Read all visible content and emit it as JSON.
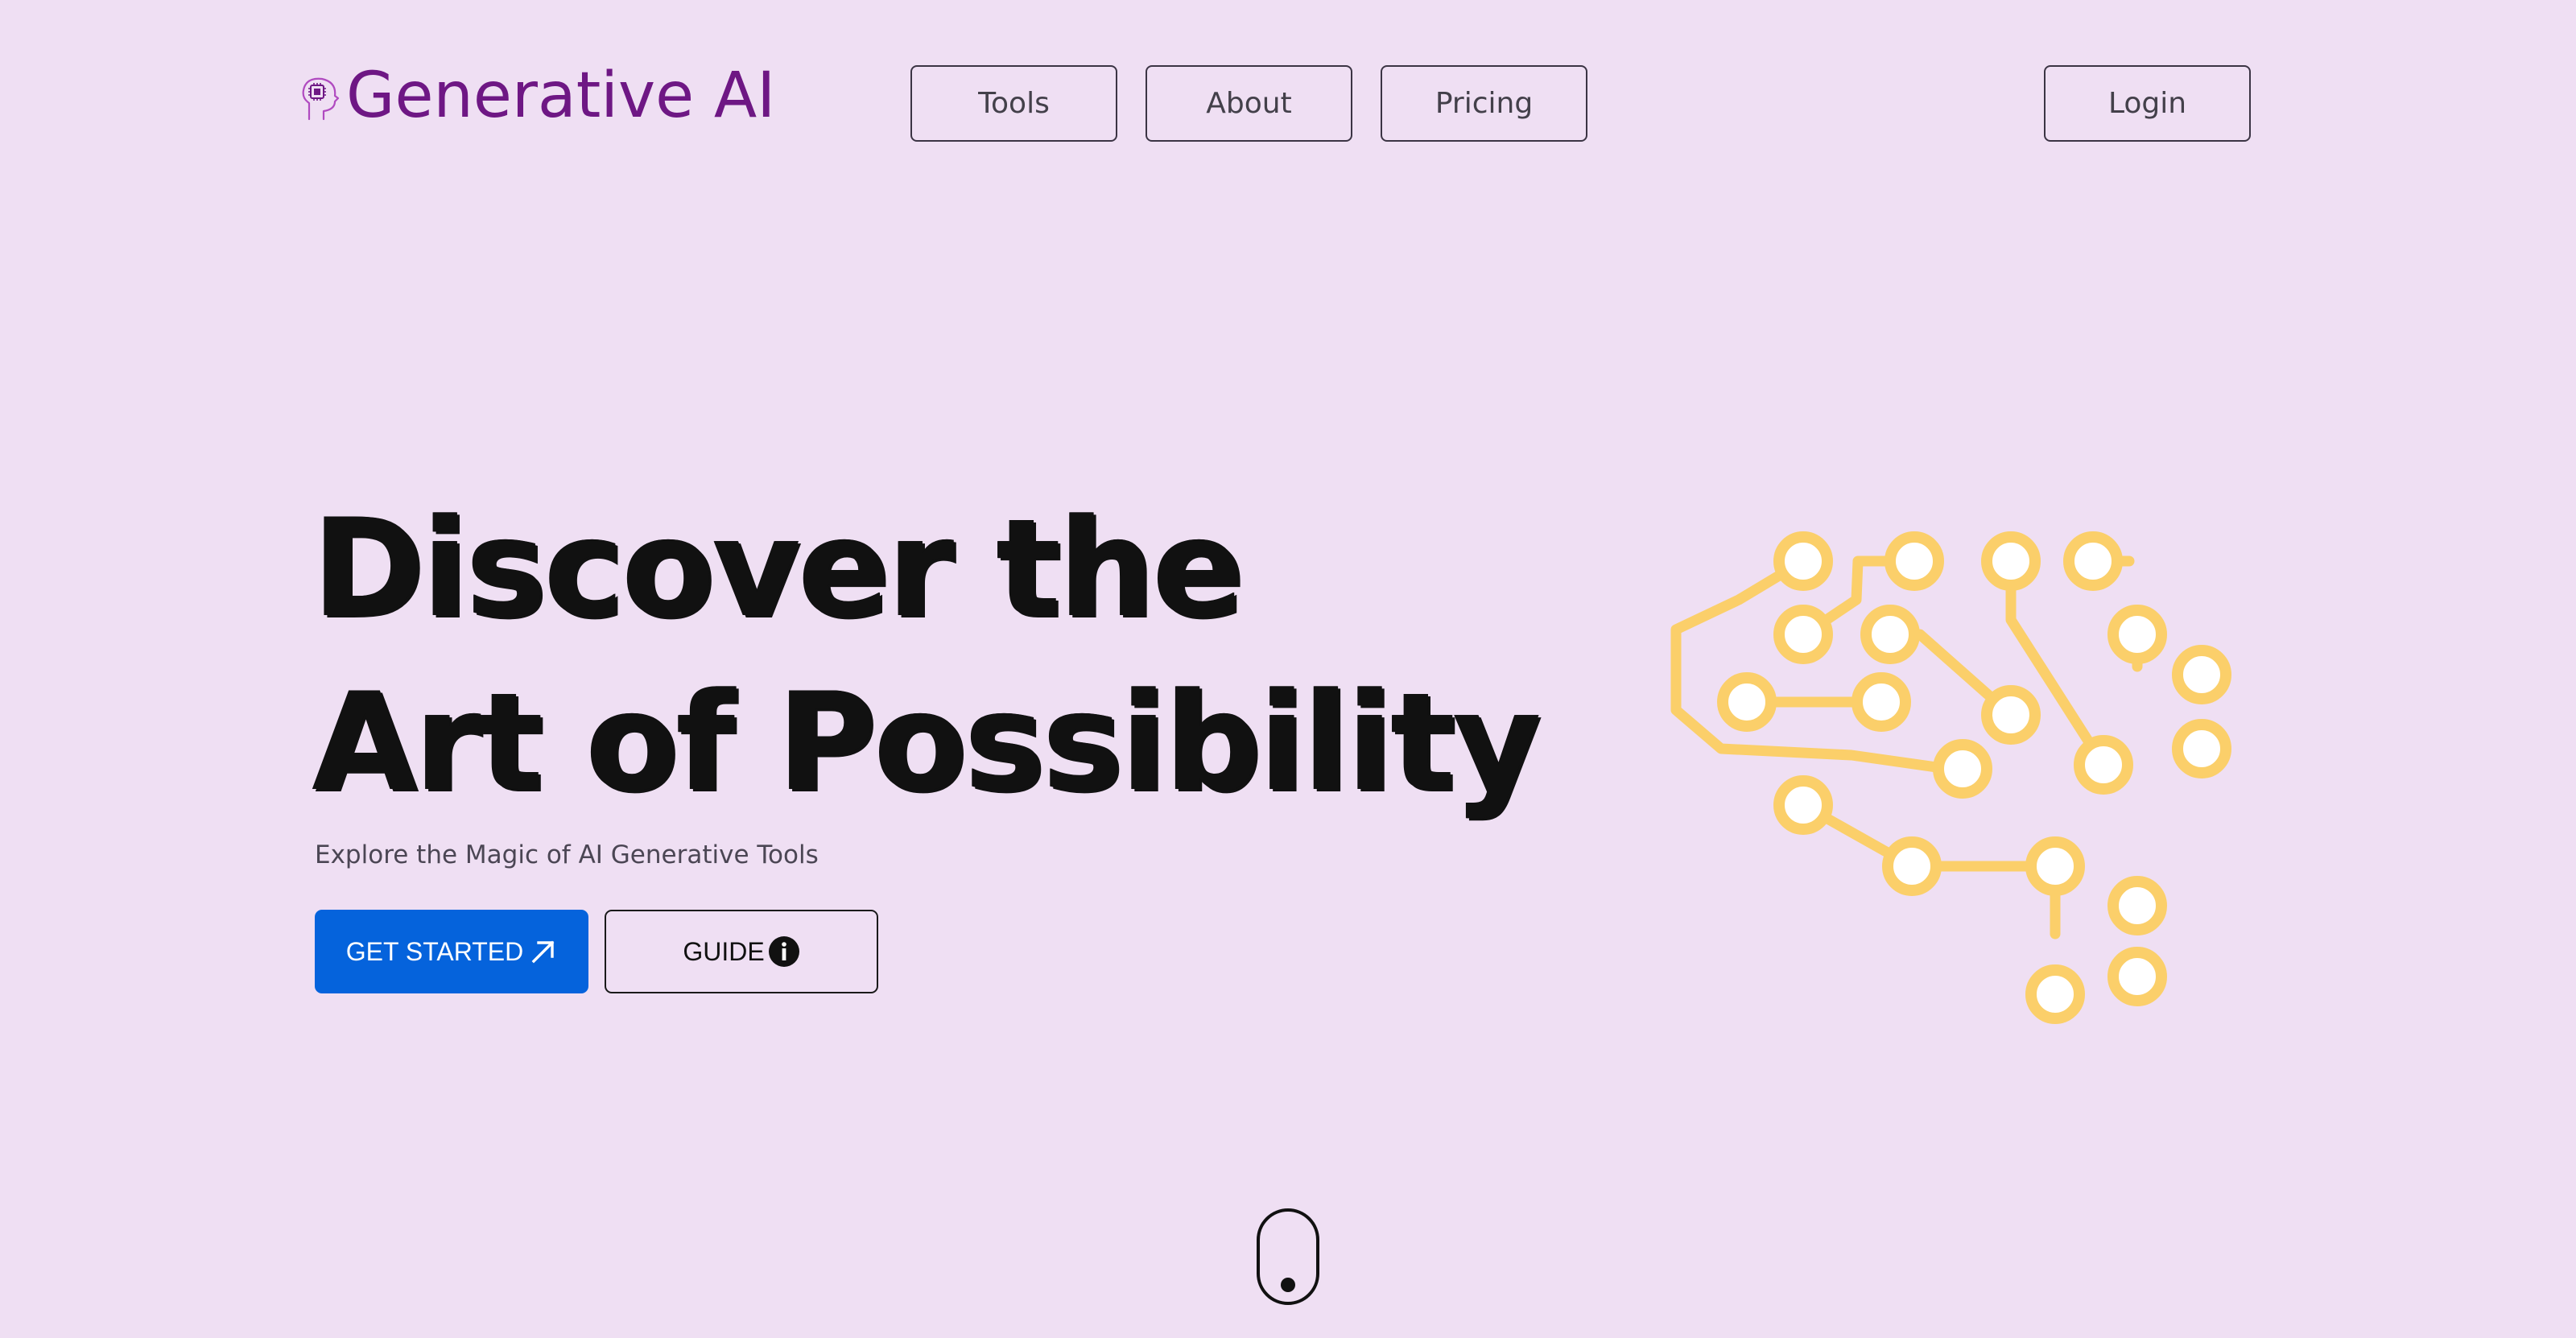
{
  "header": {
    "brand_name": "Generative AI",
    "brand_icon": "brain-chip-icon",
    "nav": [
      {
        "label": "Tools"
      },
      {
        "label": "About"
      },
      {
        "label": "Pricing"
      }
    ],
    "login_label": "Login"
  },
  "hero": {
    "title_line_1": "Discover the",
    "title_line_2": "Art of Possibility",
    "subtitle": "Explore the Magic of AI Generative Tools",
    "primary_cta": {
      "label": "GET STARTED",
      "icon": "arrow-up-right-icon"
    },
    "secondary_cta": {
      "label": "GUIDE",
      "icon": "info-circle-icon"
    }
  },
  "illustration": {
    "name": "circuit-brain-illustration",
    "color": "#fbcf6a"
  },
  "scroll_indicator": {
    "icon": "mouse-scroll-icon"
  },
  "colors": {
    "background": "#efdff3",
    "brand": "#6e1784",
    "primary": "#0563dc",
    "circuit": "#fbcf6a"
  }
}
